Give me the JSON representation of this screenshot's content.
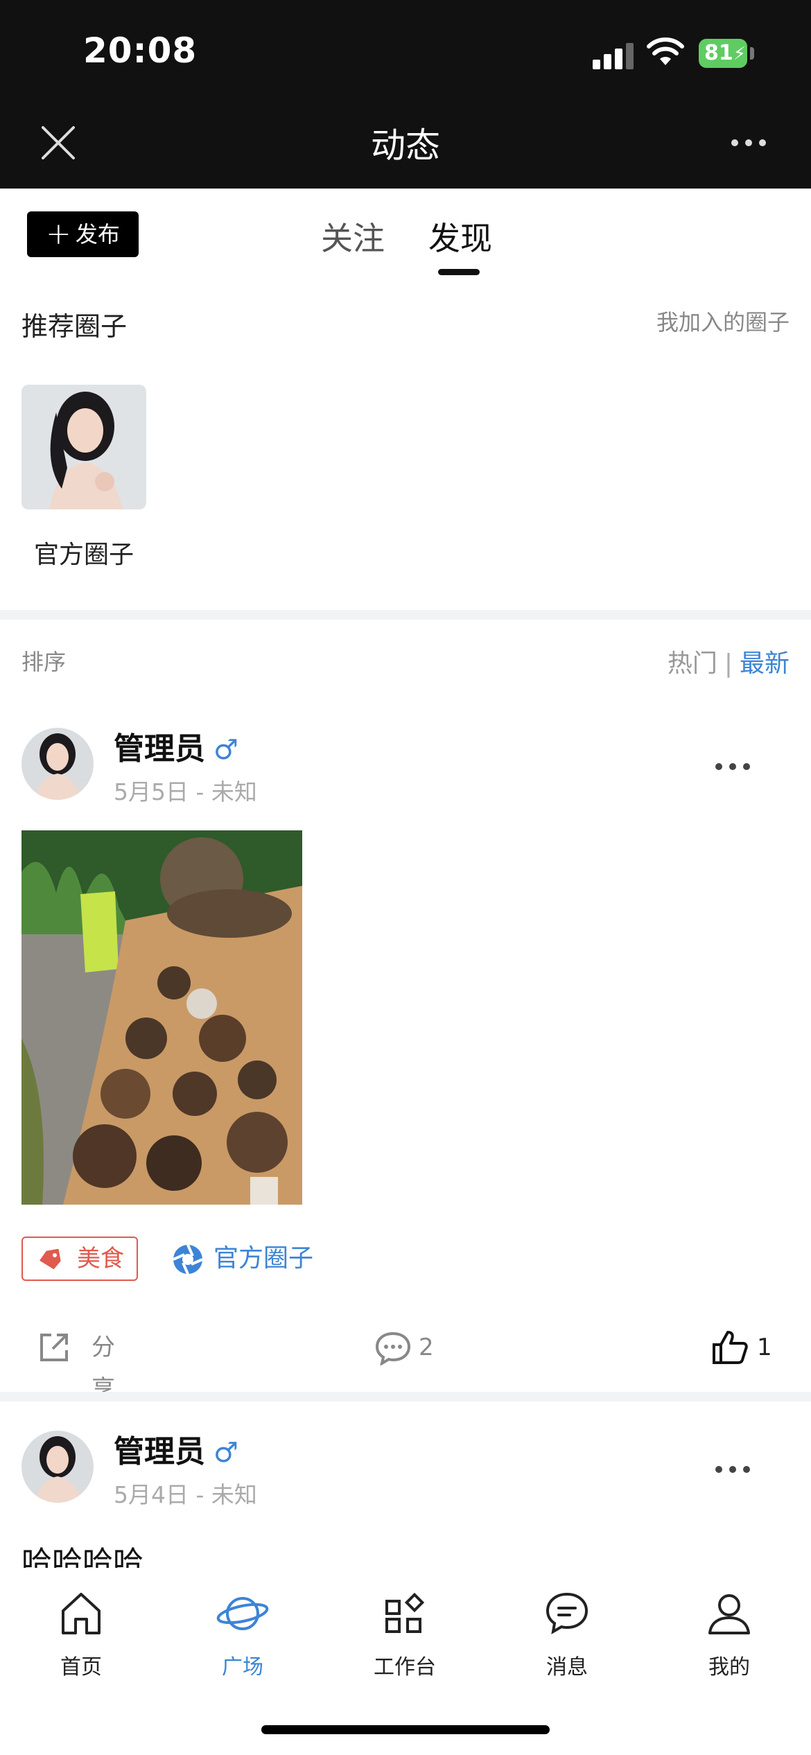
{
  "status_bar": {
    "time": "20:08",
    "battery": "81"
  },
  "header": {
    "title": "动态"
  },
  "tabs": {
    "publish_label": "发布",
    "items": [
      {
        "label": "关注",
        "active": false
      },
      {
        "label": "发现",
        "active": true
      }
    ]
  },
  "circles": {
    "section_title": "推荐圈子",
    "joined_link": "我加入的圈子",
    "items": [
      {
        "name": "官方圈子"
      }
    ]
  },
  "sort": {
    "label": "排序",
    "hot": "热门",
    "separator": "|",
    "latest": "最新",
    "active": "latest"
  },
  "posts": [
    {
      "username": "管理员",
      "gender": "♂",
      "meta": "5月5日 - 未知",
      "tag": "美食",
      "circle": "官方圈子",
      "share_label": "分享",
      "comment_count": "2",
      "like_count": "1"
    },
    {
      "username": "管理员",
      "gender": "♂",
      "meta": "5月4日 - 未知",
      "text": "哈哈哈哈"
    }
  ],
  "bottom_nav": [
    {
      "label": "首页",
      "icon": "home-icon",
      "active": false
    },
    {
      "label": "广场",
      "icon": "planet-icon",
      "active": true
    },
    {
      "label": "工作台",
      "icon": "grid-icon",
      "active": false
    },
    {
      "label": "消息",
      "icon": "chat-icon",
      "active": false
    },
    {
      "label": "我的",
      "icon": "user-icon",
      "active": false
    }
  ],
  "colors": {
    "accent": "#3d84d6",
    "tag_red": "#e05a4e",
    "header_bg": "#111111",
    "battery_green": "#5fcc62"
  }
}
